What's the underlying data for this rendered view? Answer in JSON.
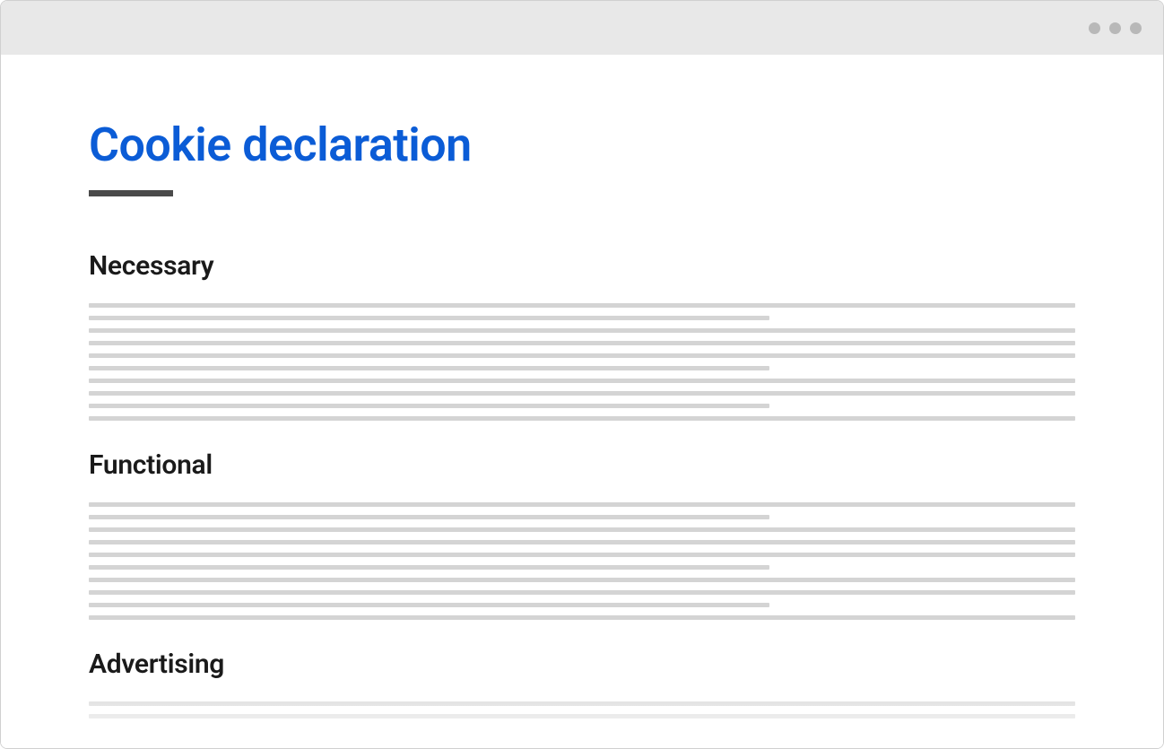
{
  "page": {
    "title": "Cookie declaration"
  },
  "sections": [
    {
      "heading": "Necessary",
      "line_pattern": [
        "full",
        "partial",
        "full",
        "full",
        "full",
        "partial",
        "full",
        "full",
        "partial",
        "full"
      ]
    },
    {
      "heading": "Functional",
      "line_pattern": [
        "full",
        "partial",
        "full",
        "full",
        "full",
        "partial",
        "full",
        "full",
        "partial",
        "full"
      ]
    },
    {
      "heading": "Advertising",
      "line_pattern": [
        "full",
        "full"
      ]
    }
  ]
}
